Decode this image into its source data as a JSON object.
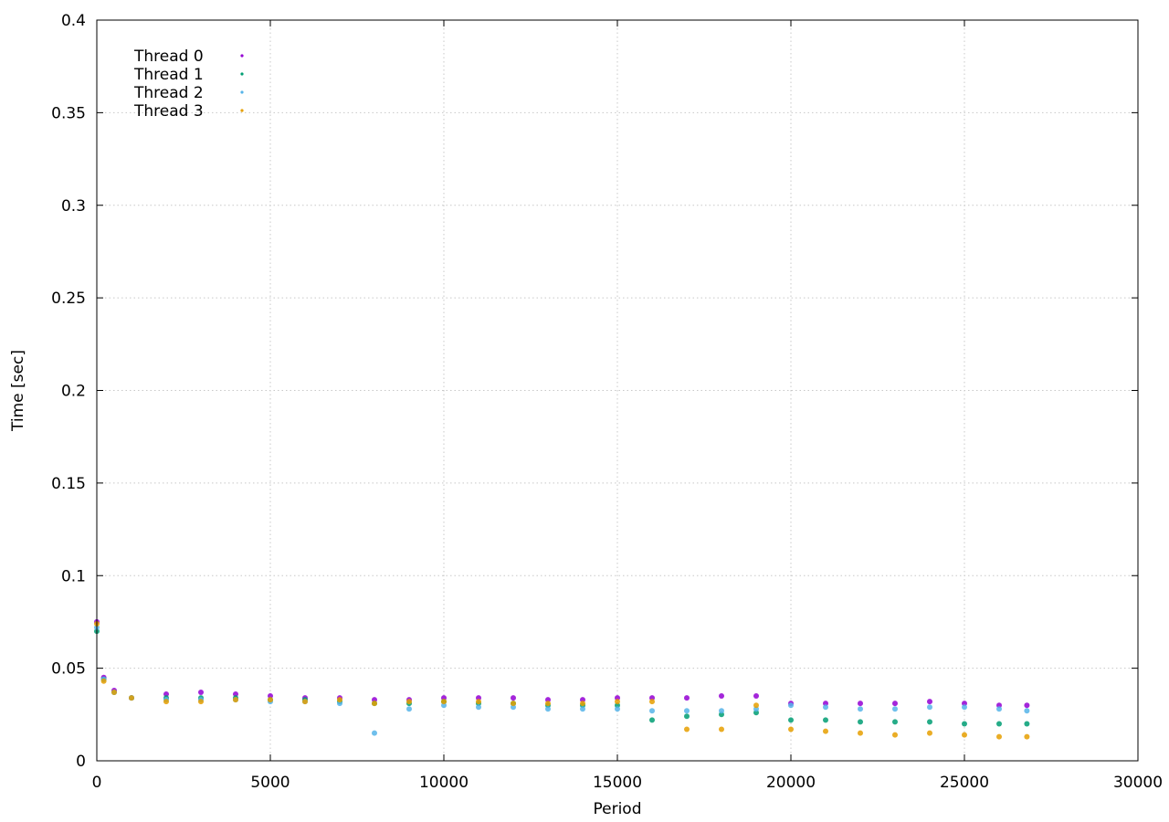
{
  "chart_data": {
    "type": "scatter",
    "title": "",
    "xlabel": "Period",
    "ylabel": "Time [sec]",
    "xlim": [
      0,
      30000
    ],
    "ylim": [
      0,
      0.4
    ],
    "x_ticks": [
      0,
      5000,
      10000,
      15000,
      20000,
      25000,
      30000
    ],
    "x_tick_labels": [
      "0",
      "5000",
      "10000",
      "15000",
      "20000",
      "25000",
      "30000"
    ],
    "y_ticks": [
      0,
      0.05,
      0.1,
      0.15,
      0.2,
      0.25,
      0.3,
      0.35,
      0.4
    ],
    "y_tick_labels": [
      "0",
      "0.05",
      "0.1",
      "0.15",
      "0.2",
      "0.25",
      "0.3",
      "0.35",
      "0.4"
    ],
    "grid": true,
    "legend_position": "top-left",
    "series": [
      {
        "name": "Thread 0",
        "color": "#9400d3",
        "x": [
          0,
          200,
          500,
          1000,
          2000,
          3000,
          4000,
          5000,
          6000,
          7000,
          8000,
          9000,
          10000,
          11000,
          12000,
          13000,
          14000,
          15000,
          16000,
          17000,
          18000,
          19000,
          20000,
          21000,
          22000,
          23000,
          24000,
          25000,
          26000,
          26800
        ],
        "y": [
          0.075,
          0.045,
          0.038,
          0.034,
          0.036,
          0.037,
          0.036,
          0.035,
          0.034,
          0.034,
          0.033,
          0.033,
          0.034,
          0.034,
          0.034,
          0.033,
          0.033,
          0.034,
          0.034,
          0.034,
          0.035,
          0.035,
          0.031,
          0.031,
          0.031,
          0.031,
          0.032,
          0.031,
          0.03,
          0.03
        ]
      },
      {
        "name": "Thread 1",
        "color": "#009e73",
        "x": [
          0,
          200,
          500,
          1000,
          2000,
          3000,
          4000,
          5000,
          6000,
          7000,
          8000,
          9000,
          10000,
          11000,
          12000,
          13000,
          14000,
          15000,
          16000,
          17000,
          18000,
          19000,
          20000,
          21000,
          22000,
          23000,
          24000,
          25000,
          26000,
          26800
        ],
        "y": [
          0.07,
          0.044,
          0.037,
          0.034,
          0.034,
          0.034,
          0.034,
          0.033,
          0.033,
          0.032,
          0.031,
          0.031,
          0.032,
          0.031,
          0.031,
          0.03,
          0.03,
          0.03,
          0.022,
          0.024,
          0.025,
          0.026,
          0.022,
          0.022,
          0.021,
          0.021,
          0.021,
          0.02,
          0.02,
          0.02
        ]
      },
      {
        "name": "Thread 2",
        "color": "#56b4e9",
        "x": [
          0,
          200,
          500,
          1000,
          2000,
          3000,
          4000,
          5000,
          6000,
          7000,
          8000,
          9000,
          10000,
          11000,
          12000,
          13000,
          14000,
          15000,
          16000,
          17000,
          18000,
          19000,
          20000,
          21000,
          22000,
          23000,
          24000,
          25000,
          26000,
          26800
        ],
        "y": [
          0.072,
          0.044,
          0.037,
          0.034,
          0.033,
          0.033,
          0.033,
          0.032,
          0.032,
          0.031,
          0.015,
          0.028,
          0.03,
          0.029,
          0.029,
          0.028,
          0.028,
          0.028,
          0.027,
          0.027,
          0.027,
          0.028,
          0.03,
          0.029,
          0.028,
          0.028,
          0.029,
          0.029,
          0.028,
          0.027
        ]
      },
      {
        "name": "Thread 3",
        "color": "#e69f00",
        "x": [
          0,
          200,
          500,
          1000,
          2000,
          3000,
          4000,
          5000,
          6000,
          7000,
          8000,
          9000,
          10000,
          11000,
          12000,
          13000,
          14000,
          15000,
          16000,
          17000,
          18000,
          19000,
          20000,
          21000,
          22000,
          23000,
          24000,
          25000,
          26000,
          26800
        ],
        "y": [
          0.074,
          0.043,
          0.037,
          0.034,
          0.032,
          0.032,
          0.033,
          0.033,
          0.032,
          0.033,
          0.031,
          0.032,
          0.032,
          0.032,
          0.031,
          0.031,
          0.031,
          0.032,
          0.032,
          0.017,
          0.017,
          0.03,
          0.017,
          0.016,
          0.015,
          0.014,
          0.015,
          0.014,
          0.013,
          0.013
        ]
      }
    ]
  }
}
